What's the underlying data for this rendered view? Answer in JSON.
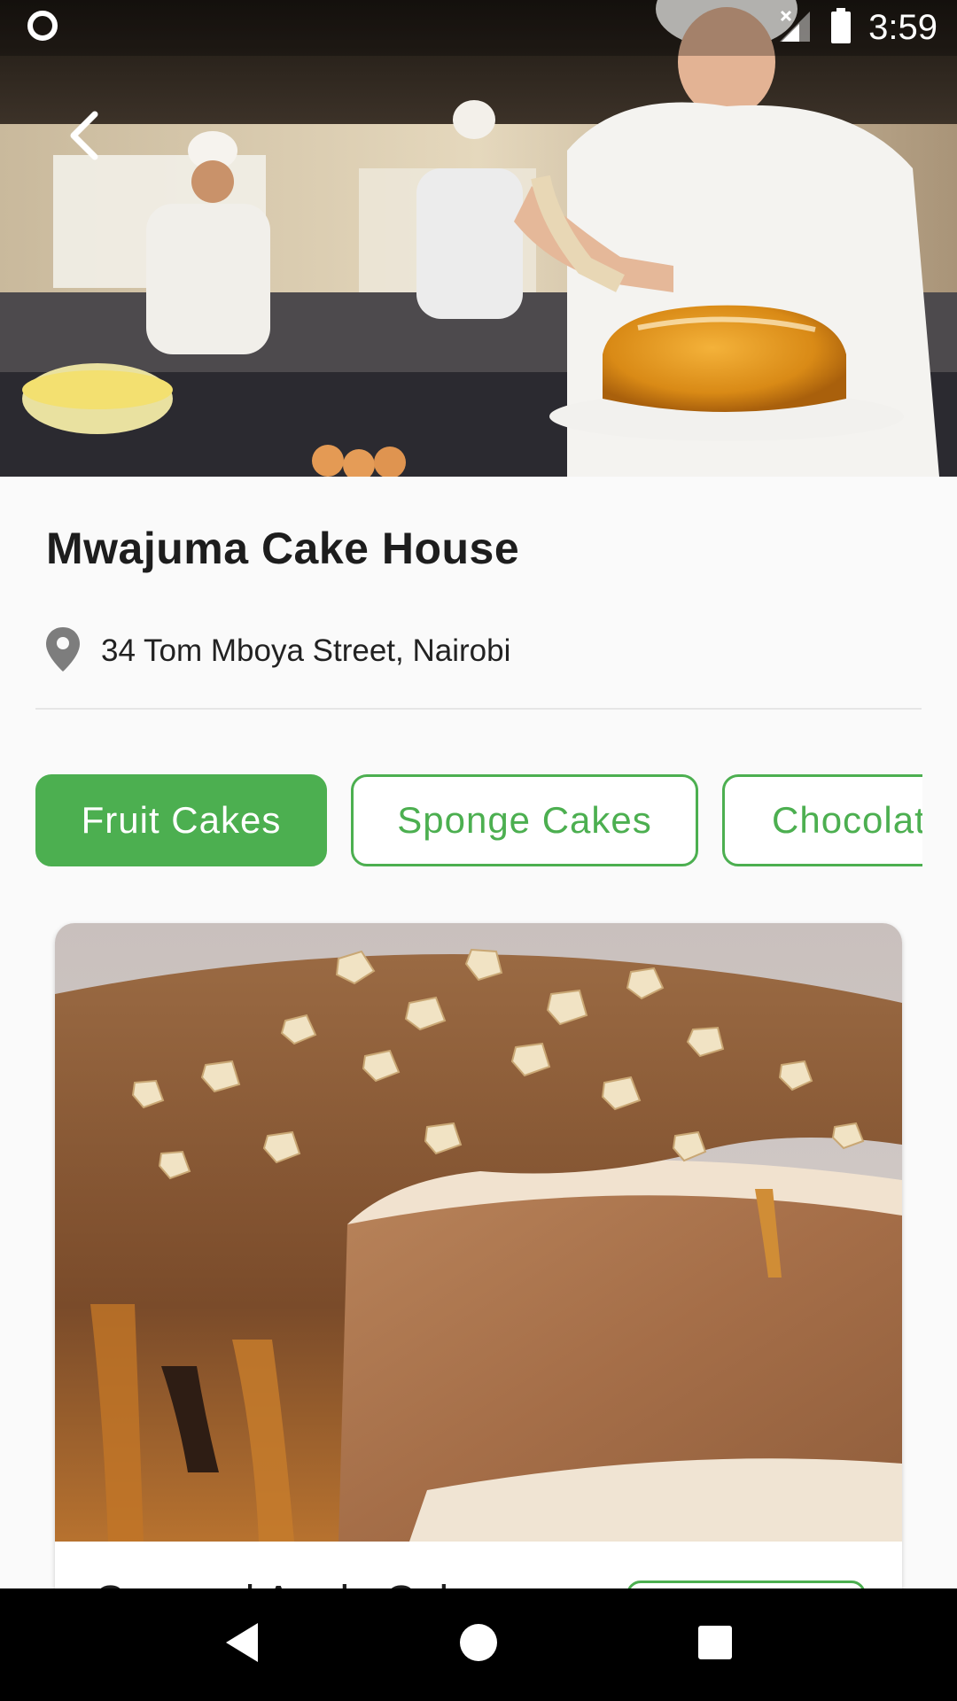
{
  "status_bar": {
    "time": "3:59",
    "icons": [
      "record-indicator-icon",
      "no-signal-icon",
      "battery-icon"
    ]
  },
  "hero": {
    "image": "bakery-chefs-decorating-cake-photo",
    "back_icon": "chevron-left-icon"
  },
  "shop": {
    "name": "Mwajuma Cake House",
    "address": "34 Tom Mboya Street, Nairobi",
    "address_icon": "location-pin-icon"
  },
  "categories": [
    {
      "label": "Fruit Cakes",
      "selected": true
    },
    {
      "label": "Sponge Cakes",
      "selected": false
    },
    {
      "label": "Chocolate",
      "selected": false
    }
  ],
  "product": {
    "image": "caramel-nut-sponge-cake-photo",
    "name": "Caramel Apple Cake",
    "button_label": ""
  },
  "nav": {
    "icons": [
      "back-triangle-icon",
      "home-circle-icon",
      "recents-square-icon"
    ]
  },
  "colors": {
    "accent": "#4caf50",
    "background": "#fafafa",
    "text": "#1d1d1d"
  }
}
